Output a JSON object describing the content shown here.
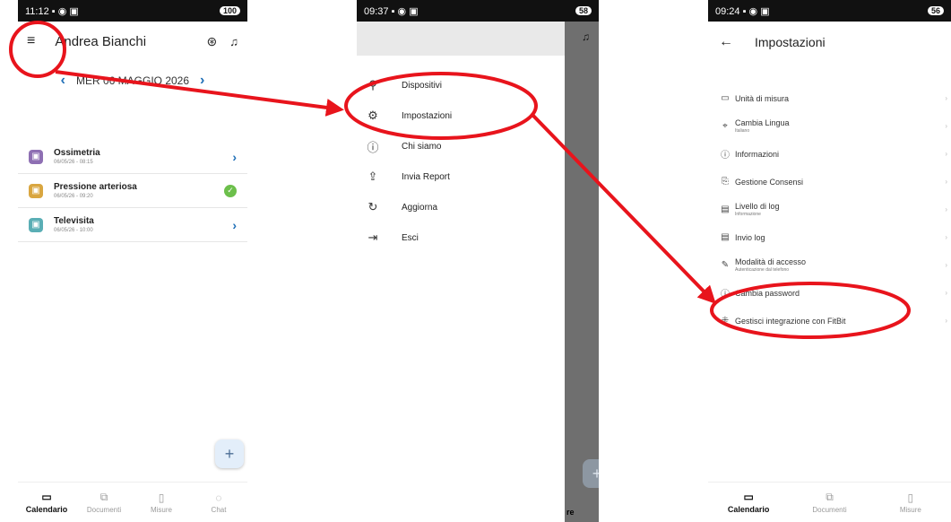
{
  "screen1": {
    "status": {
      "time": "11:12",
      "icons": "▪ ◉ ▣",
      "battery": "100"
    },
    "header": {
      "title": "Andrea Bianchi",
      "menu_icon": "menu-icon",
      "profile_icon": "profile-icon",
      "bell_icon": "bell-icon"
    },
    "date": {
      "label": "MER 06 MAGGIO 2026",
      "prev": "‹",
      "next": "›"
    },
    "appointments": [
      {
        "name": "Ossimetria",
        "time": "06/05/26 - 08:15",
        "icon_color": "#8e6fb3",
        "status": "arrow"
      },
      {
        "name": "Pressione arteriosa",
        "time": "06/05/26 - 09:20",
        "icon_color": "#d9a640",
        "status": "done"
      },
      {
        "name": "Televisita",
        "time": "06/05/26 - 10:00",
        "icon_color": "#5aaeb5",
        "status": "arrow"
      }
    ],
    "fab": "+",
    "bottom_nav": [
      "Calendario",
      "Documenti",
      "Misure",
      "Chat"
    ]
  },
  "screen2": {
    "status": {
      "time": "09:37",
      "icons": "▪ ◉ ▣",
      "battery": "58"
    },
    "menu": [
      {
        "label": "Dispositivi",
        "icon": "devices-icon",
        "glyph": "⚲"
      },
      {
        "label": "Impostazioni",
        "icon": "settings-icon",
        "glyph": "⚙"
      },
      {
        "label": "Chi siamo",
        "icon": "info-icon",
        "glyph": "ⓘ"
      },
      {
        "label": "Invia Report",
        "icon": "upload-icon",
        "glyph": "⇪"
      },
      {
        "label": "Aggiorna",
        "icon": "refresh-icon",
        "glyph": "↻"
      },
      {
        "label": "Esci",
        "icon": "exit-icon",
        "glyph": "⇥"
      }
    ],
    "partial_text": "re",
    "fab": "+"
  },
  "screen3": {
    "status": {
      "time": "09:24",
      "icons": "▪ ◉ ▣",
      "battery": "56"
    },
    "header": {
      "title": "Impostazioni",
      "back": "←"
    },
    "items": [
      {
        "label": "Unità di misura",
        "sub": "",
        "glyph": "▭"
      },
      {
        "label": "Cambia Lingua",
        "sub": "Italiano",
        "glyph": "⌖"
      },
      {
        "label": "Informazioni",
        "sub": "",
        "glyph": "ⓘ"
      },
      {
        "label": "Gestione Consensi",
        "sub": "",
        "glyph": "⎘"
      },
      {
        "label": "Livello di log",
        "sub": "Informazione",
        "glyph": "▤"
      },
      {
        "label": "Invio log",
        "sub": "",
        "glyph": "▤"
      },
      {
        "label": "Modalità di accesso",
        "sub": "Autenticazione dal telefono",
        "glyph": "✎"
      },
      {
        "label": "Cambia password",
        "sub": "",
        "glyph": "ⓘ"
      },
      {
        "label": "Gestisci integrazione con FitBit",
        "sub": "",
        "glyph": "⁜"
      }
    ],
    "bottom_nav": [
      "Calendario",
      "Documenti",
      "Misure"
    ]
  },
  "annotation_color": "#e8141c"
}
